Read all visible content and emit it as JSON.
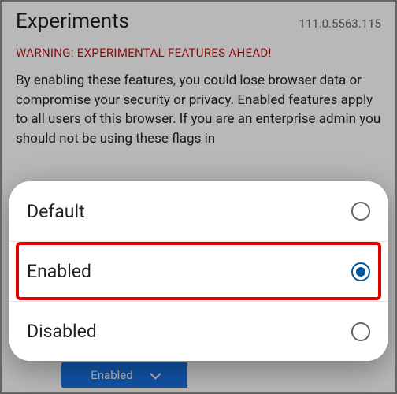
{
  "header": {
    "title": "Experiments",
    "version": "111.0.5563.115"
  },
  "warning": "WARNING: EXPERIMENTAL FEATURES AHEAD!",
  "body_text": "By enabling these features, you could lose browser data or compromise your security or privacy. Enabled features apply to all users of this browser. If you are an enterprise admin you should not be using these flags in",
  "selected_dropdown_label": "Enabled",
  "options": [
    {
      "label": "Default",
      "selected": false
    },
    {
      "label": "Enabled",
      "selected": true
    },
    {
      "label": "Disabled",
      "selected": false
    }
  ]
}
